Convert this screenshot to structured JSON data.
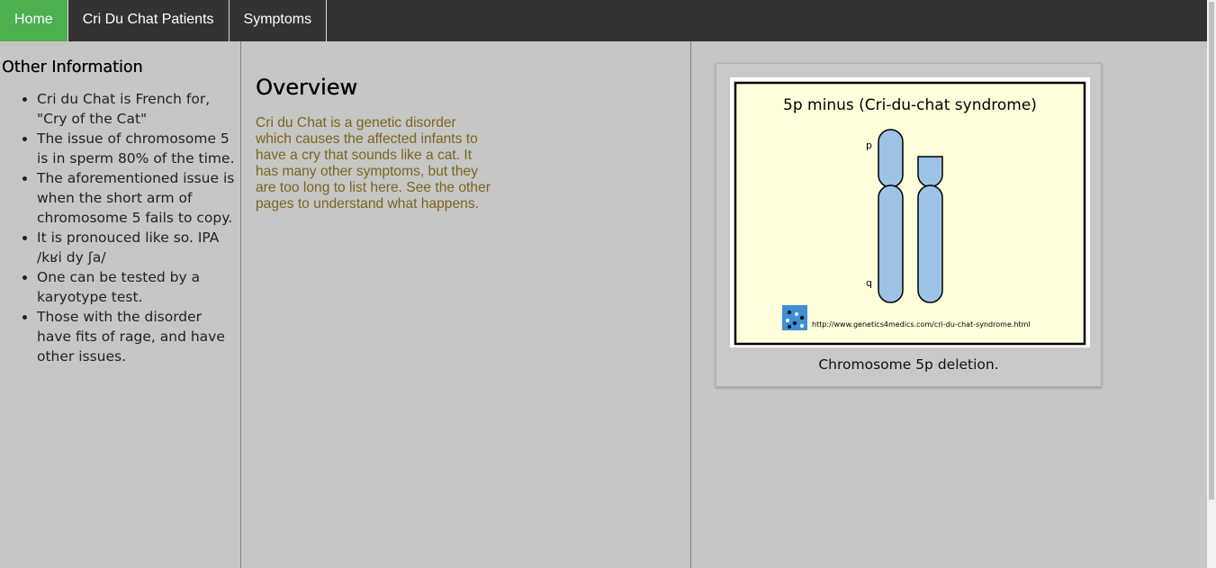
{
  "nav": {
    "items": [
      {
        "label": "Home",
        "active": true
      },
      {
        "label": "Cri Du Chat Patients",
        "active": false
      },
      {
        "label": "Symptoms",
        "active": false
      }
    ]
  },
  "sidebar": {
    "heading": "Other Information",
    "items": [
      "Cri du Chat is French for, \"Cry of the Cat\"",
      "The issue of chromosome 5 is in sperm 80% of the time.",
      "The aforementioned issue is when the short arm of chromosome 5 fails to copy.",
      "It is pronouced like so. IPA /kʁi dy ʃa/",
      "One can be tested by a karyotype test.",
      "Those with the disorder have fits of rage, and have other issues."
    ]
  },
  "main": {
    "title": "Overview",
    "body": "Cri du Chat is a genetic disorder which causes the affected infants to have a cry that sounds like a cat. It has many other symptoms, but they are too long to list here. See the other pages to understand what happens."
  },
  "figure": {
    "image_title": "5p minus (Cri-du-chat syndrome)",
    "label_p": "p",
    "label_q": "q",
    "image_url_text": "http://www.genetics4medics.com/cri-du-chat-syndrome.html",
    "caption": "Chromosome 5p deletion."
  },
  "colors": {
    "nav_bg": "#333333",
    "nav_active": "#4caf50",
    "page_bg": "#c6c6c4",
    "body_text": "#7d6320",
    "figure_bg": "#ffffdc",
    "chromosome": "#9dc3e6"
  }
}
